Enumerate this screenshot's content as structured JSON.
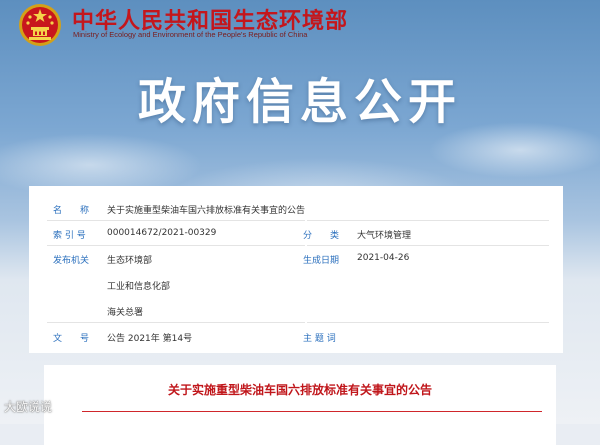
{
  "header": {
    "ministry_cn": "中华人民共和国生态环境部",
    "ministry_en": "Ministry of Ecology and Environment of the People's Republic of China",
    "emblem_icon": "national-emblem-icon"
  },
  "banner": {
    "title": "政府信息公开"
  },
  "meta": {
    "name_label": "名　　称",
    "name_value": "关于实施重型柴油车国六排放标准有关事宜的公告",
    "index_label": "索 引 号",
    "index_value": "000014672/2021-00329",
    "category_label": "分　　类",
    "category_value": "大气环境管理",
    "issuer_label": "发布机关",
    "issuers": [
      "生态环境部",
      "工业和信息化部",
      "海关总署"
    ],
    "date_label": "生成日期",
    "date_value": "2021-04-26",
    "docno_label": "文　　号",
    "docno_value": "公告 2021年 第14号",
    "topic_label": "主 题 词",
    "topic_value": ""
  },
  "content": {
    "title": "关于实施重型柴油车国六排放标准有关事宜的公告"
  },
  "watermark": {
    "text": "大欧说说"
  },
  "colors": {
    "brand_red": "#c4161c",
    "label_blue": "#2a6fbd",
    "title_red": "#c0161b"
  }
}
